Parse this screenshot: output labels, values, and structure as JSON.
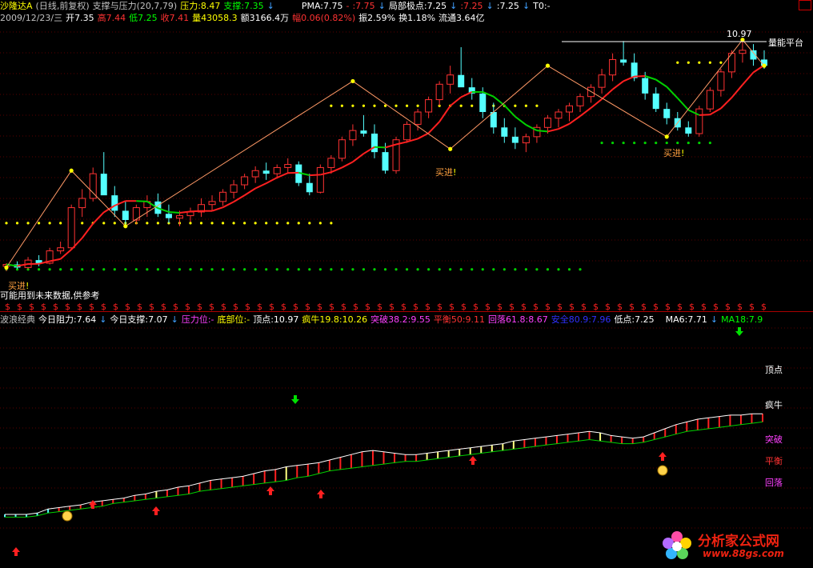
{
  "header1": {
    "stock": "沙隆达A",
    "period": "(日线,前复权)",
    "indicator": "支撑与压力(20,7,79)",
    "pressure": "压力:8.47",
    "support": "支撑:7.35",
    "pma": "PMA:7.75",
    "v1": ":7.75",
    "local": "局部极点:7.25",
    "v2": ":7.25",
    "v3": ":7.25",
    "t0": "T0:-"
  },
  "header2": {
    "date": "2009/12/23/三",
    "open": "开7.35",
    "high": "高7.44",
    "low": "低7.25",
    "close": "收7.41",
    "vol": "量43058.3",
    "amount": "额3166.4万",
    "change": "幅0.06(0.82%)",
    "swing": "振2.59%",
    "turnover": "换1.18%",
    "float": "流通3.64亿"
  },
  "header3": {
    "name": "波浪经典",
    "resist": "今日阻力:7.64",
    "support": "今日支撑:7.07",
    "pressure_pos": "压力位:-",
    "bottom_pos": "底部位:-",
    "top": "顶点:10.97",
    "crazy": "疯牛19.8:10.26",
    "break": "突破38.2:9.55",
    "balance": "平衡50:9.11",
    "fall": "回落61.8:8.67",
    "safe": "安全80.9:7.96",
    "low": "低点:7.25",
    "ma6": "MA6:7.71",
    "ma18": "MA18:7.9"
  },
  "labels": {
    "buy": "买进",
    "buy_mark": "!",
    "warning": "可能用到未来数据,供参考",
    "platform": "量能平台",
    "peak": "10.97",
    "levels": [
      "顶点",
      "疯牛",
      "突破",
      "平衡",
      "回落"
    ],
    "dollar": "$"
  },
  "watermark": {
    "title": "分析家公式网",
    "url": "www.88gs.com"
  },
  "colors": {
    "up": "#ff3232",
    "down": "#54ffff",
    "ma_red": "#ff2020",
    "ma_green": "#00d000",
    "ma_white": "#ffffff",
    "dots_yellow": "#ffff00",
    "dots_green": "#00d000",
    "zigzag": "#ff9966",
    "blue_candle": "#0000ff",
    "yellow_candle": "#ffff00"
  },
  "chart_data": [
    {
      "type": "candlestick",
      "title": "支撑与压力(20,7,79)",
      "xlabel": "",
      "ylabel": "",
      "price_range": [
        7.0,
        11.2
      ],
      "bars": [
        [
          7.3,
          7.35,
          7.22,
          7.33
        ],
        [
          7.33,
          7.38,
          7.26,
          7.28
        ],
        [
          7.28,
          7.45,
          7.25,
          7.4
        ],
        [
          7.4,
          7.48,
          7.3,
          7.35
        ],
        [
          7.35,
          7.6,
          7.33,
          7.55
        ],
        [
          7.55,
          7.7,
          7.5,
          7.6
        ],
        [
          7.6,
          8.3,
          7.58,
          8.25
        ],
        [
          8.25,
          8.55,
          8.1,
          8.4
        ],
        [
          8.4,
          8.9,
          8.35,
          8.8
        ],
        [
          8.8,
          9.15,
          8.6,
          8.45
        ],
        [
          8.45,
          8.6,
          8.1,
          8.2
        ],
        [
          8.2,
          8.35,
          7.95,
          8.05
        ],
        [
          8.05,
          8.3,
          7.98,
          8.25
        ],
        [
          8.25,
          8.45,
          8.1,
          8.35
        ],
        [
          8.35,
          8.48,
          8.1,
          8.15
        ],
        [
          8.15,
          8.3,
          8.0,
          8.08
        ],
        [
          8.08,
          8.2,
          7.95,
          8.12
        ],
        [
          8.12,
          8.25,
          8.02,
          8.18
        ],
        [
          8.18,
          8.4,
          8.1,
          8.3
        ],
        [
          8.3,
          8.45,
          8.2,
          8.35
        ],
        [
          8.35,
          8.55,
          8.28,
          8.5
        ],
        [
          8.5,
          8.7,
          8.4,
          8.62
        ],
        [
          8.62,
          8.8,
          8.55,
          8.75
        ],
        [
          8.75,
          8.92,
          8.65,
          8.85
        ],
        [
          8.85,
          8.98,
          8.7,
          8.8
        ],
        [
          8.8,
          8.95,
          8.72,
          8.9
        ],
        [
          8.9,
          9.05,
          8.8,
          8.95
        ],
        [
          8.95,
          9.0,
          8.6,
          8.65
        ],
        [
          8.65,
          8.8,
          8.45,
          8.5
        ],
        [
          8.5,
          8.95,
          8.48,
          8.9
        ],
        [
          8.9,
          9.1,
          8.8,
          9.05
        ],
        [
          9.05,
          9.4,
          9.0,
          9.35
        ],
        [
          9.35,
          9.6,
          9.25,
          9.5
        ],
        [
          9.5,
          9.75,
          9.4,
          9.45
        ],
        [
          9.45,
          9.6,
          9.05,
          9.15
        ],
        [
          9.15,
          9.3,
          8.8,
          8.85
        ],
        [
          8.85,
          9.4,
          8.8,
          9.35
        ],
        [
          9.35,
          9.65,
          9.3,
          9.6
        ],
        [
          9.6,
          9.85,
          9.5,
          9.8
        ],
        [
          9.8,
          10.05,
          9.7,
          10.0
        ],
        [
          10.0,
          10.3,
          9.9,
          10.25
        ],
        [
          10.25,
          10.55,
          10.1,
          10.4
        ],
        [
          10.4,
          10.85,
          10.3,
          10.2
        ],
        [
          10.2,
          10.35,
          10.0,
          10.1
        ],
        [
          10.1,
          10.2,
          9.7,
          9.8
        ],
        [
          9.8,
          9.95,
          9.45,
          9.55
        ],
        [
          9.55,
          9.7,
          9.3,
          9.4
        ],
        [
          9.4,
          9.55,
          9.2,
          9.3
        ],
        [
          9.3,
          9.45,
          9.15,
          9.4
        ],
        [
          9.4,
          9.6,
          9.3,
          9.55
        ],
        [
          9.55,
          9.75,
          9.45,
          9.7
        ],
        [
          9.7,
          9.85,
          9.55,
          9.8
        ],
        [
          9.8,
          9.95,
          9.65,
          9.9
        ],
        [
          9.9,
          10.1,
          9.8,
          10.05
        ],
        [
          10.05,
          10.25,
          9.95,
          10.2
        ],
        [
          10.2,
          10.5,
          10.1,
          10.4
        ],
        [
          10.4,
          10.75,
          10.3,
          10.65
        ],
        [
          10.65,
          10.95,
          10.55,
          10.6
        ],
        [
          10.6,
          10.75,
          10.3,
          10.35
        ],
        [
          10.35,
          10.45,
          10.0,
          10.1
        ],
        [
          10.1,
          10.2,
          9.8,
          9.85
        ],
        [
          9.85,
          9.95,
          9.6,
          9.7
        ],
        [
          9.7,
          9.8,
          9.5,
          9.55
        ],
        [
          9.55,
          9.65,
          9.4,
          9.45
        ],
        [
          9.45,
          9.9,
          9.4,
          9.85
        ],
        [
          9.85,
          10.2,
          9.8,
          10.15
        ],
        [
          10.15,
          10.5,
          10.05,
          10.45
        ],
        [
          10.45,
          10.8,
          10.35,
          10.75
        ],
        [
          10.75,
          10.97,
          10.6,
          10.8
        ],
        [
          10.8,
          10.9,
          10.55,
          10.65
        ],
        [
          10.65,
          10.8,
          10.5,
          10.55
        ]
      ]
    },
    {
      "type": "line",
      "title": "波浪经典",
      "xlabel": "",
      "ylabel": "",
      "y_range": [
        0,
        100
      ],
      "upper": [
        10,
        10,
        10,
        11,
        14,
        15,
        16,
        17,
        19,
        20,
        21,
        22,
        24,
        25,
        27,
        28,
        30,
        31,
        33,
        35,
        36,
        37,
        38,
        40,
        42,
        43,
        45,
        46,
        47,
        48,
        50,
        52,
        54,
        56,
        57,
        56,
        55,
        54,
        54,
        55,
        56,
        57,
        58,
        59,
        60,
        61,
        62,
        64,
        65,
        66,
        67,
        68,
        69,
        70,
        71,
        70,
        68,
        67,
        66,
        67,
        70,
        73,
        76,
        78,
        80,
        81,
        82,
        83,
        83,
        84,
        84
      ],
      "lower": [
        8,
        8,
        8,
        9,
        11,
        12,
        13,
        14,
        15,
        16,
        18,
        19,
        20,
        21,
        22,
        23,
        24,
        25,
        27,
        28,
        29,
        30,
        31,
        32,
        33,
        34,
        35,
        37,
        38,
        40,
        42,
        43,
        44,
        45,
        46,
        47,
        48,
        49,
        49,
        50,
        51,
        52,
        53,
        54,
        55,
        56,
        57,
        58,
        59,
        60,
        61,
        62,
        63,
        64,
        65,
        64,
        63,
        62,
        62,
        63,
        65,
        67,
        69,
        71,
        72,
        73,
        74,
        75,
        76,
        77,
        78
      ]
    }
  ]
}
